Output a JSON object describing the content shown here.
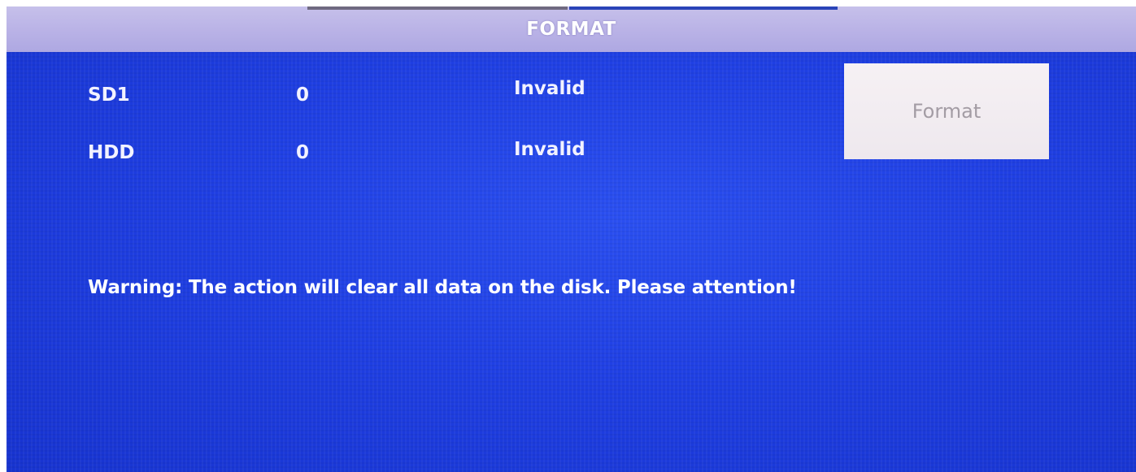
{
  "window": {
    "title": "FORMAT"
  },
  "disks": [
    {
      "name": "SD1",
      "size": "0",
      "status": "Invalid"
    },
    {
      "name": "HDD",
      "size": "0",
      "status": "Invalid"
    }
  ],
  "actions": {
    "format_label": "Format"
  },
  "warning": {
    "text": "Warning: The action will clear all data on the disk. Please attention!"
  },
  "colors": {
    "panel_background": "#1f3fe3",
    "title_bar": "#b9b2e6",
    "text": "#ffffff",
    "button_background": "#f2edf2",
    "button_text": "#a39ca4"
  }
}
